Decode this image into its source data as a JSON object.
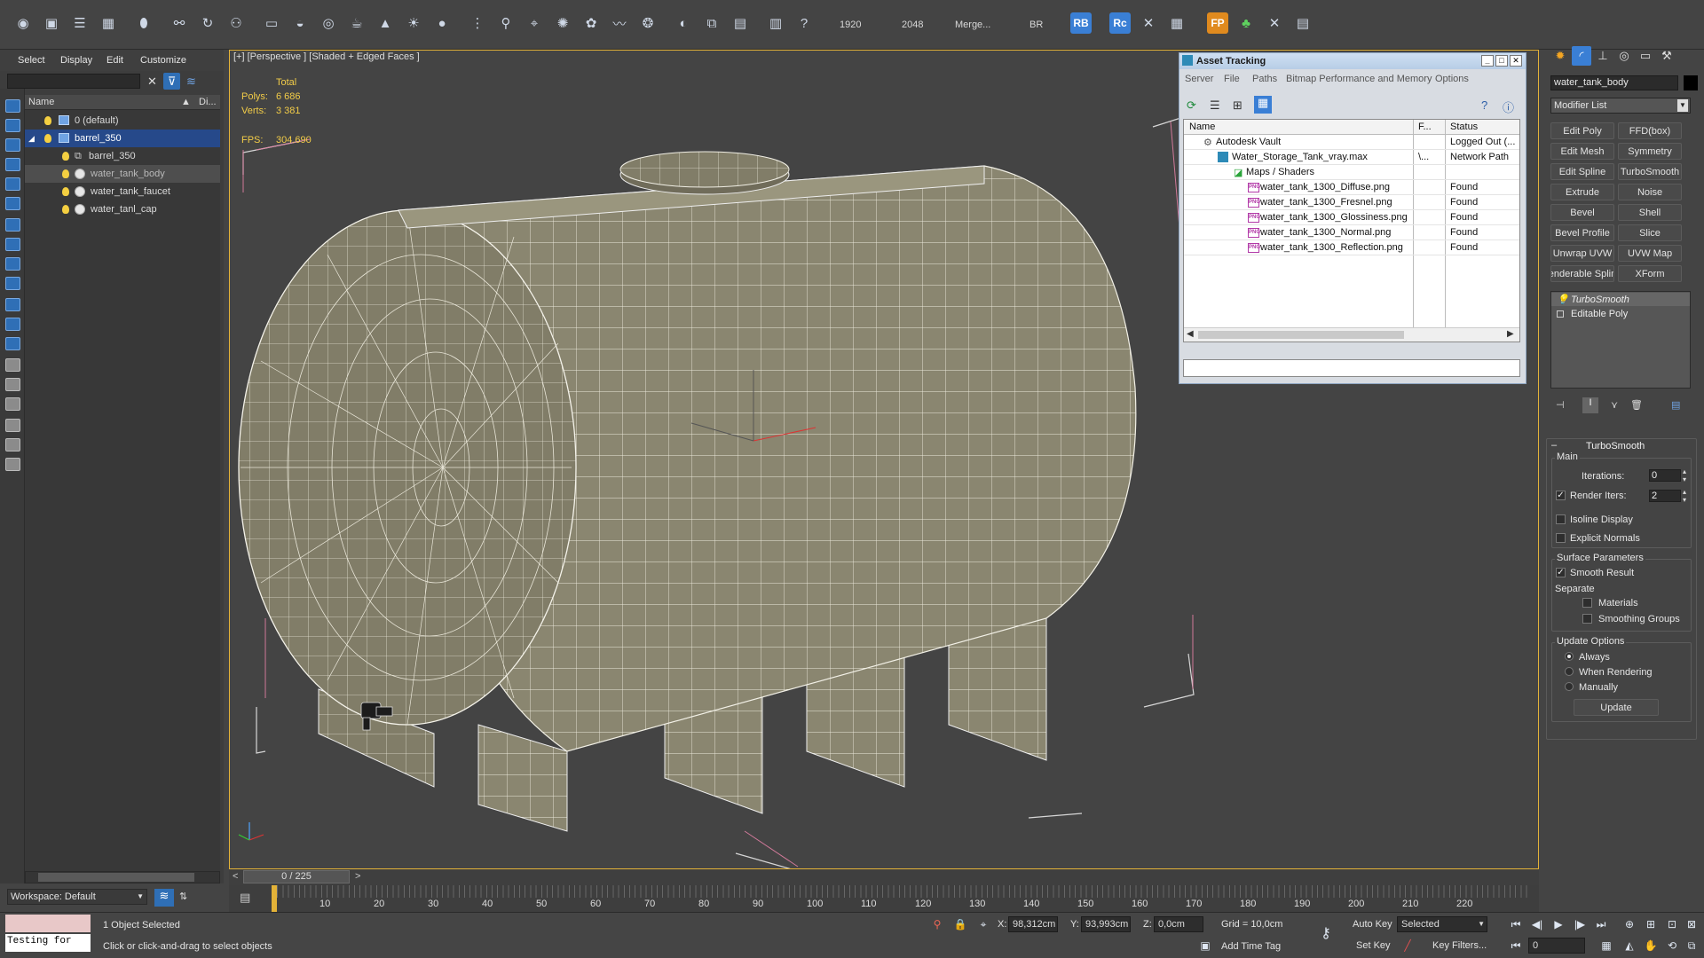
{
  "toolbar": {
    "render_width": "1920",
    "render_height": "2048",
    "merge_label": "Merge...",
    "br_label": "BR",
    "rb_label": "RB",
    "rc_label": "Rc",
    "fp_label": "FP"
  },
  "explorer": {
    "menu": [
      "Select",
      "Display",
      "Edit",
      "Customize"
    ],
    "header_name": "Name",
    "header_di": "Di...",
    "items": [
      {
        "label": "0 (default)",
        "kind": "layer"
      },
      {
        "label": "barrel_350",
        "kind": "layer",
        "selected": true
      },
      {
        "label": "barrel_350",
        "kind": "group"
      },
      {
        "label": "water_tank_body",
        "kind": "object",
        "highlighted": true
      },
      {
        "label": "water_tank_faucet",
        "kind": "object"
      },
      {
        "label": "water_tanl_cap",
        "kind": "object"
      }
    ],
    "workspace": "Workspace: Default"
  },
  "viewport": {
    "label": "[+] [Perspective ] [Shaded + Edged Faces ]",
    "stats_header": "Total",
    "polys_label": "Polys:",
    "polys_value": "6 686",
    "verts_label": "Verts:",
    "verts_value": "3 381",
    "fps_label": "FPS:",
    "fps_value": "304.690",
    "frame_counter": "0 / 225"
  },
  "asset_tracking": {
    "title": "Asset Tracking",
    "menu": [
      "Server",
      "File",
      "Paths",
      "Bitmap Performance and Memory",
      "Options"
    ],
    "columns": [
      "Name",
      "F...",
      "Status"
    ],
    "rows": [
      {
        "name": "Autodesk Vault",
        "f": "",
        "status": "Logged Out (...",
        "indent": 1,
        "icon": "vault"
      },
      {
        "name": "Water_Storage_Tank_vray.max",
        "f": "\\...",
        "status": "Network Path",
        "indent": 2,
        "icon": "max"
      },
      {
        "name": "Maps / Shaders",
        "f": "",
        "status": "",
        "indent": 3,
        "icon": "maps"
      },
      {
        "name": "water_tank_1300_Diffuse.png",
        "f": "",
        "status": "Found",
        "indent": 4,
        "icon": "png"
      },
      {
        "name": "water_tank_1300_Fresnel.png",
        "f": "",
        "status": "Found",
        "indent": 4,
        "icon": "png"
      },
      {
        "name": "water_tank_1300_Glossiness.png",
        "f": "",
        "status": "Found",
        "indent": 4,
        "icon": "png"
      },
      {
        "name": "water_tank_1300_Normal.png",
        "f": "",
        "status": "Found",
        "indent": 4,
        "icon": "png"
      },
      {
        "name": "water_tank_1300_Reflection.png",
        "f": "",
        "status": "Found",
        "indent": 4,
        "icon": "png"
      }
    ],
    "png_badge": "PNG"
  },
  "command_panel": {
    "object_name": "water_tank_body",
    "modifier_list": "Modifier List",
    "modifier_buttons": [
      "Edit Poly",
      "FFD(box)",
      "Edit Mesh",
      "Symmetry",
      "Edit Spline",
      "TurboSmooth",
      "Extrude",
      "Noise",
      "Bevel",
      "Shell",
      "Bevel Profile",
      "Slice",
      "Unwrap UVW",
      "UVW Map",
      "enderable Splin",
      "XForm"
    ],
    "stack": [
      "TurboSmooth",
      "Editable Poly"
    ],
    "turbosmooth": {
      "title": "TurboSmooth",
      "main_label": "Main",
      "iterations_label": "Iterations:",
      "iterations_value": "0",
      "render_iters_label": "Render Iters:",
      "render_iters_value": "2",
      "render_iters_checked": true,
      "isoline_label": "Isoline Display",
      "explicit_label": "Explicit Normals",
      "surface_label": "Surface Parameters",
      "smooth_result_label": "Smooth Result",
      "smooth_result_checked": true,
      "separate_label": "Separate",
      "materials_label": "Materials",
      "smoothing_groups_label": "Smoothing Groups",
      "update_options_label": "Update Options",
      "always_label": "Always",
      "when_rendering_label": "When Rendering",
      "manually_label": "Manually",
      "update_button": "Update"
    }
  },
  "timeline": {
    "ticks": [
      "10",
      "20",
      "30",
      "40",
      "50",
      "60",
      "70",
      "80",
      "90",
      "100",
      "110",
      "120",
      "130",
      "140",
      "150",
      "160",
      "170",
      "180",
      "190",
      "200",
      "210",
      "220"
    ],
    "tick_values": [
      10,
      20,
      30,
      40,
      50,
      60,
      70,
      80,
      90,
      100,
      110,
      120,
      130,
      140,
      150,
      160,
      170,
      180,
      190,
      200,
      210,
      220
    ]
  },
  "status": {
    "listener_text": "Testing for",
    "selection": "1 Object Selected",
    "prompt": "Click or click-and-drag to select objects",
    "x_label": "X:",
    "x_value": "98,312cm",
    "y_label": "Y:",
    "y_value": "93,993cm",
    "z_label": "Z:",
    "z_value": "0,0cm",
    "grid": "Grid = 10,0cm",
    "add_time_tag": "Add Time Tag",
    "auto_key": "Auto Key",
    "set_key": "Set Key",
    "selected_option": "Selected",
    "key_filters": "Key Filters...",
    "frame_value": "0"
  },
  "colors": {
    "selection_blue": "#26498a",
    "viewport_border": "#e3b238",
    "stat_yellow": "#f2cc48",
    "tank_fill": "#8a8670"
  }
}
